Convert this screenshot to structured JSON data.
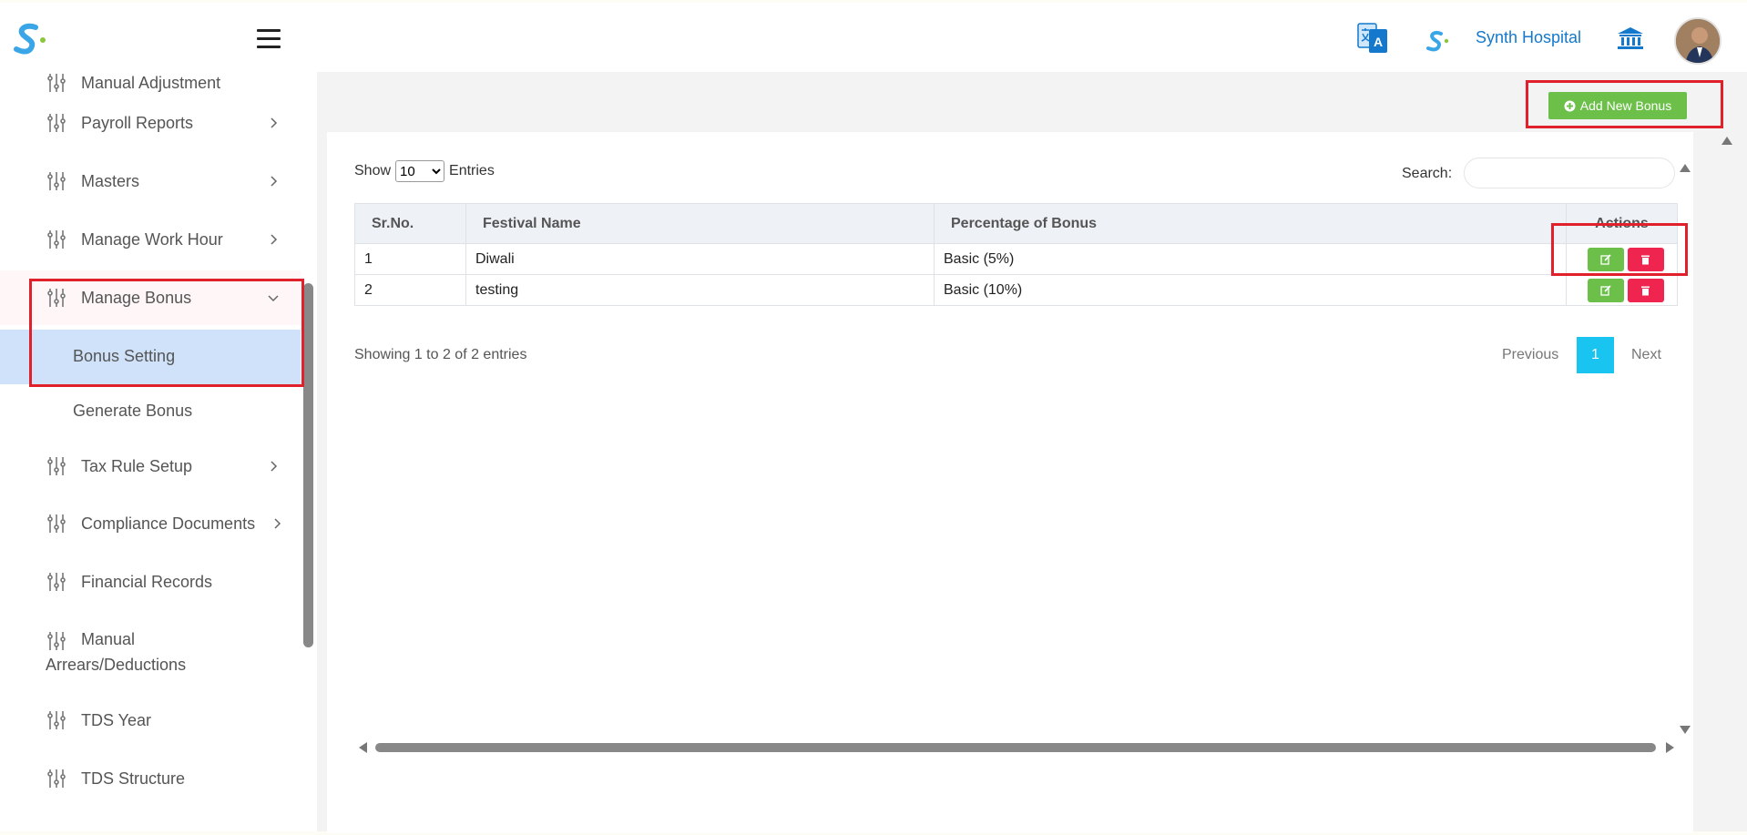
{
  "header": {
    "hospital_name": "Synth Hospital",
    "brand_color": "#1479cc",
    "icons": [
      "logo-icon",
      "menu-icon",
      "translate-icon",
      "hospital-logo-icon",
      "bank-icon",
      "avatar"
    ]
  },
  "sidebar": {
    "items": [
      {
        "label": "Manual Adjustment",
        "icon": "sliders-icon"
      },
      {
        "label": "Payroll Reports",
        "icon": "sliders-icon"
      },
      {
        "label": "Masters",
        "icon": "sliders-icon"
      },
      {
        "label": "Manage Work Hour",
        "icon": "sliders-icon"
      },
      {
        "label": "Manage Bonus",
        "icon": "sliders-icon",
        "expanded": true
      },
      {
        "label": "Bonus Setting",
        "active": true
      },
      {
        "label": "Generate Bonus"
      },
      {
        "label": "Tax Rule Setup",
        "icon": "sliders-icon"
      },
      {
        "label": "Compliance Documents",
        "icon": "sliders-icon"
      },
      {
        "label": "Financial Records",
        "icon": "sliders-icon"
      },
      {
        "label_line1": "Manual",
        "label_line2": "Arrears/Deductions",
        "icon": "sliders-icon"
      },
      {
        "label": "TDS Year",
        "icon": "sliders-icon"
      },
      {
        "label": "TDS Structure",
        "icon": "sliders-icon"
      }
    ]
  },
  "toolbar": {
    "add_label": "Add New Bonus"
  },
  "table_controls": {
    "show_label": "Show",
    "entries_label": "Entries",
    "page_size": "10",
    "search_label": "Search:"
  },
  "table": {
    "headers": [
      "Sr.No.",
      "Festival Name",
      "Percentage of Bonus",
      "Actions"
    ],
    "rows": [
      [
        "1",
        "Diwali",
        "Basic (5%)"
      ],
      [
        "2",
        "testing",
        "Basic (10%)"
      ]
    ]
  },
  "pagination": {
    "summary": "Showing 1 to 2 of 2 entries",
    "previous": "Previous",
    "current_page": "1",
    "next": "Next"
  },
  "colors": {
    "accent_green": "#6cc04a",
    "danger": "#f0254f",
    "page_active": "#19c4f0",
    "highlight": "#e0202a"
  }
}
